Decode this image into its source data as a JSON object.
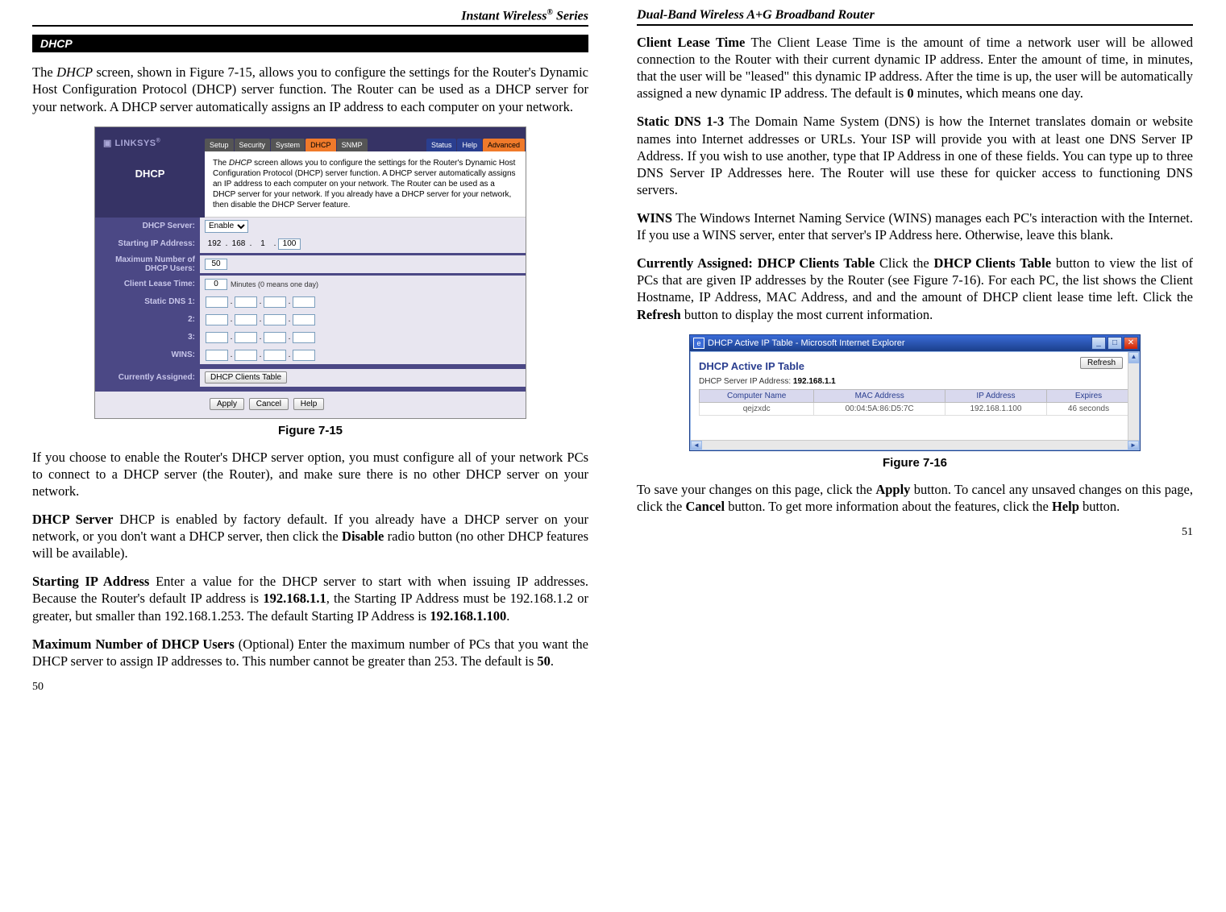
{
  "left": {
    "series_header": "Instant Wireless",
    "series_suffix": " Series",
    "reg": "®",
    "section_title": "DHCP",
    "para1_pre": "The ",
    "para1_it": "DHCP",
    "para1_post": " screen, shown in Figure 7-15, allows you to configure the settings for the Router's Dynamic Host Configuration Protocol (DHCP) server function. The Router can be used as a DHCP server for your network. A DHCP server automatically assigns an IP address to each computer on your network.",
    "fig_caption": "Figure 7-15",
    "para2": "If you choose to enable the Router's DHCP server option, you must configure all of your network PCs to connect to a DHCP server (the Router), and make sure there is no other DHCP server on your network.",
    "para3_b": "DHCP Server",
    "para3_rest": "   DHCP is enabled by factory default. If you already have a DHCP server on your network, or you don't want a DHCP server, then click the ",
    "para3_b2": "Disable",
    "para3_rest2": " radio button (no other DHCP features will be available).",
    "para4_b": "Starting IP Address",
    "para4_rest": "   Enter a value for the DHCP server to start with when issuing IP addresses.  Because the Router's default IP address is ",
    "para4_b2": "192.168.1.1",
    "para4_rest2": ", the Starting IP Address must be 192.168.1.2 or greater, but smaller than 192.168.1.253. The default Starting IP Address is ",
    "para4_b3": "192.168.1.100",
    "para4_rest3": ".",
    "para5_b": "Maximum Number of DHCP Users",
    "para5_rest": "  (Optional) Enter the maximum number of PCs that you want the DHCP server to assign IP addresses to. This number cannot be greater than 253. The default is ",
    "para5_b2": "50",
    "para5_rest2": ".",
    "page_num": "50"
  },
  "right": {
    "title_header": "Dual-Band Wireless A+G Broadband Router",
    "para1_b": "Client Lease Time",
    "para1_rest": "  The Client Lease Time is the amount of time a network user will be allowed connection to the Router with their current dynamic IP address. Enter the amount of time, in minutes, that the user will be \"leased\" this dynamic IP address. After the time is up, the user will be automatically assigned a new dynamic IP address. The default is ",
    "para1_b2": "0",
    "para1_rest2": " minutes, which means one day.",
    "para2_b": "Static DNS 1-3",
    "para2_rest": "  The Domain Name System (DNS) is how the Internet translates domain or website names into Internet addresses or URLs. Your ISP will provide you with at least one DNS Server IP Address. If you wish to use another, type that IP Address in one of these fields. You can type up to three DNS Server IP Addresses here. The Router will use these for quicker access to functioning DNS servers.",
    "para3_b": "WINS",
    "para3_rest": "   The Windows Internet Naming Service (WINS) manages each PC's interaction with the Internet. If you use a WINS server, enter that server's IP Address here. Otherwise, leave this blank.",
    "para4_b": "Currently Assigned: DHCP Clients Table",
    "para4_rest": "   Click the ",
    "para4_b2": "DHCP Clients Table",
    "para4_rest2": " button to view the list of PCs that are given IP addresses by the Router (see Figure 7-16). For each PC, the list shows the Client Hostname, IP Address, MAC Address, and and the amount of DHCP client lease time left. Click the ",
    "para4_b3": "Refresh",
    "para4_rest3": " button to display the most current information.",
    "fig_caption": "Figure 7-16",
    "para5_rest1": "To save your changes on this page, click the ",
    "para5_b1": "Apply",
    "para5_rest2": " button. To cancel any unsaved changes on this page, click the ",
    "para5_b2": "Cancel",
    "para5_rest3": " button. To get more information about the features, click the ",
    "para5_b3": "Help",
    "para5_rest4": " button.",
    "page_num": "51"
  },
  "router": {
    "logo": "LINKSYS",
    "logo_sup": "®",
    "tabs": {
      "setup": "Setup",
      "security": "Security",
      "system": "System",
      "dhcp": "DHCP",
      "snmp": "SNMP",
      "status": "Status",
      "help": "Help",
      "advanced": "Advanced"
    },
    "side_title": "DHCP",
    "desc_pre": "The ",
    "desc_it": "DHCP",
    "desc_post": " screen allows you to configure the settings for the Router's Dynamic Host Configuration Protocol (DHCP) server function. A DHCP server automatically assigns an IP address to each computer on your network. The Router can be used as a DHCP server for your network. If you already have a DHCP server for your network, then disable the DHCP Server feature.",
    "labels": {
      "server": "DHCP Server:",
      "start": "Starting IP Address:",
      "max": "Maximum Number of DHCP Users:",
      "lease": "Client Lease Time:",
      "dns1": "Static DNS 1:",
      "dns2": "2:",
      "dns3": "3:",
      "wins": "WINS:",
      "assigned": "Currently Assigned:"
    },
    "server_value": "Enable",
    "ip_octets": {
      "a": "192",
      "b": "168",
      "c": "1",
      "d": "100"
    },
    "max_value": "50",
    "lease_value": "0",
    "lease_note": "Minutes (0 means one day)",
    "clients_btn": "DHCP Clients Table",
    "apply": "Apply",
    "cancel": "Cancel",
    "help": "Help"
  },
  "ie": {
    "title": "DHCP Active IP Table - Microsoft Internet Explorer",
    "heading": "DHCP Active IP Table",
    "refresh": "Refresh",
    "sub_label": "DHCP Server IP Address:  ",
    "sub_value": "192.168.1.1",
    "cols": {
      "name": "Computer Name",
      "mac": "MAC Address",
      "ip": "IP Address",
      "exp": "Expires"
    },
    "row": {
      "name": "qejzxdc",
      "mac": "00:04:5A:86:D5:7C",
      "ip": "192.168.1.100",
      "exp": "46 seconds"
    }
  }
}
